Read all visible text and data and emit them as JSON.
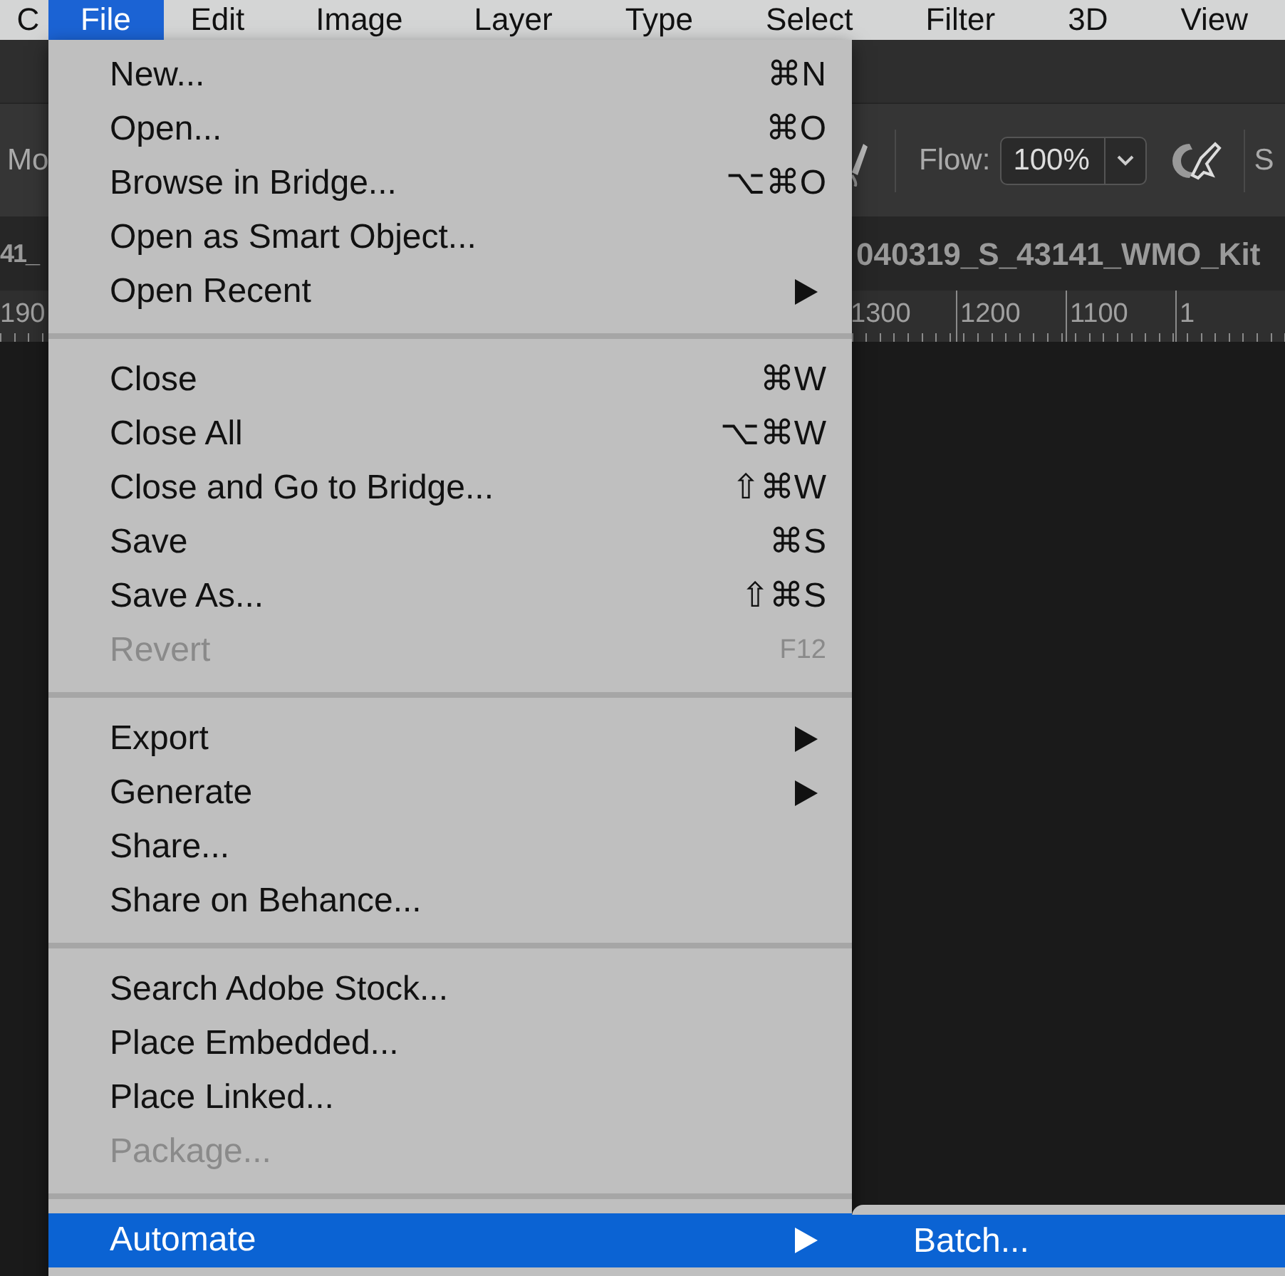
{
  "menubar": {
    "items": [
      {
        "label": "C",
        "selected": false
      },
      {
        "label": "File",
        "selected": true
      },
      {
        "label": "Edit",
        "selected": false
      },
      {
        "label": "Image",
        "selected": false
      },
      {
        "label": "Layer",
        "selected": false
      },
      {
        "label": "Type",
        "selected": false
      },
      {
        "label": "Select",
        "selected": false
      },
      {
        "label": "Filter",
        "selected": false
      },
      {
        "label": "3D",
        "selected": false
      },
      {
        "label": "View",
        "selected": false
      }
    ]
  },
  "options_bar": {
    "left_text": "Mo",
    "flow_label": "Flow:",
    "flow_value": "100%",
    "right_text": "S"
  },
  "document_tabs": {
    "left_title": "41_",
    "right_title": "040319_S_43141_WMO_Kit"
  },
  "ruler": {
    "left_label": "190",
    "labels": [
      "1300",
      "1200",
      "1100",
      "1"
    ]
  },
  "file_menu": {
    "sections": [
      [
        {
          "label": "New...",
          "shortcut": "⌘N",
          "submenu": false,
          "disabled": false,
          "selected": false
        },
        {
          "label": "Open...",
          "shortcut": "⌘O",
          "submenu": false,
          "disabled": false,
          "selected": false
        },
        {
          "label": "Browse in Bridge...",
          "shortcut": "⌥⌘O",
          "submenu": false,
          "disabled": false,
          "selected": false
        },
        {
          "label": "Open as Smart Object...",
          "submenu": false,
          "disabled": false,
          "selected": false
        },
        {
          "label": "Open Recent",
          "submenu": true,
          "disabled": false,
          "selected": false
        }
      ],
      [
        {
          "label": "Close",
          "shortcut": "⌘W",
          "submenu": false,
          "disabled": false,
          "selected": false
        },
        {
          "label": "Close All",
          "shortcut": "⌥⌘W",
          "submenu": false,
          "disabled": false,
          "selected": false
        },
        {
          "label": "Close and Go to Bridge...",
          "shortcut": "⇧⌘W",
          "submenu": false,
          "disabled": false,
          "selected": false
        },
        {
          "label": "Save",
          "shortcut": "⌘S",
          "submenu": false,
          "disabled": false,
          "selected": false
        },
        {
          "label": "Save As...",
          "shortcut": "⇧⌘S",
          "submenu": false,
          "disabled": false,
          "selected": false
        },
        {
          "label": "Revert",
          "shortcut": "F12",
          "submenu": false,
          "disabled": true,
          "selected": false
        }
      ],
      [
        {
          "label": "Export",
          "submenu": true,
          "disabled": false,
          "selected": false
        },
        {
          "label": "Generate",
          "submenu": true,
          "disabled": false,
          "selected": false
        },
        {
          "label": "Share...",
          "submenu": false,
          "disabled": false,
          "selected": false
        },
        {
          "label": "Share on Behance...",
          "submenu": false,
          "disabled": false,
          "selected": false
        }
      ],
      [
        {
          "label": "Search Adobe Stock...",
          "submenu": false,
          "disabled": false,
          "selected": false
        },
        {
          "label": "Place Embedded...",
          "submenu": false,
          "disabled": false,
          "selected": false
        },
        {
          "label": "Place Linked...",
          "submenu": false,
          "disabled": false,
          "selected": false
        },
        {
          "label": "Package...",
          "submenu": false,
          "disabled": true,
          "selected": false
        }
      ],
      [
        {
          "label": "Automate",
          "submenu": true,
          "disabled": false,
          "selected": true
        }
      ]
    ]
  },
  "automate_submenu": {
    "items": [
      {
        "label": "Batch...",
        "selected": true
      }
    ]
  }
}
